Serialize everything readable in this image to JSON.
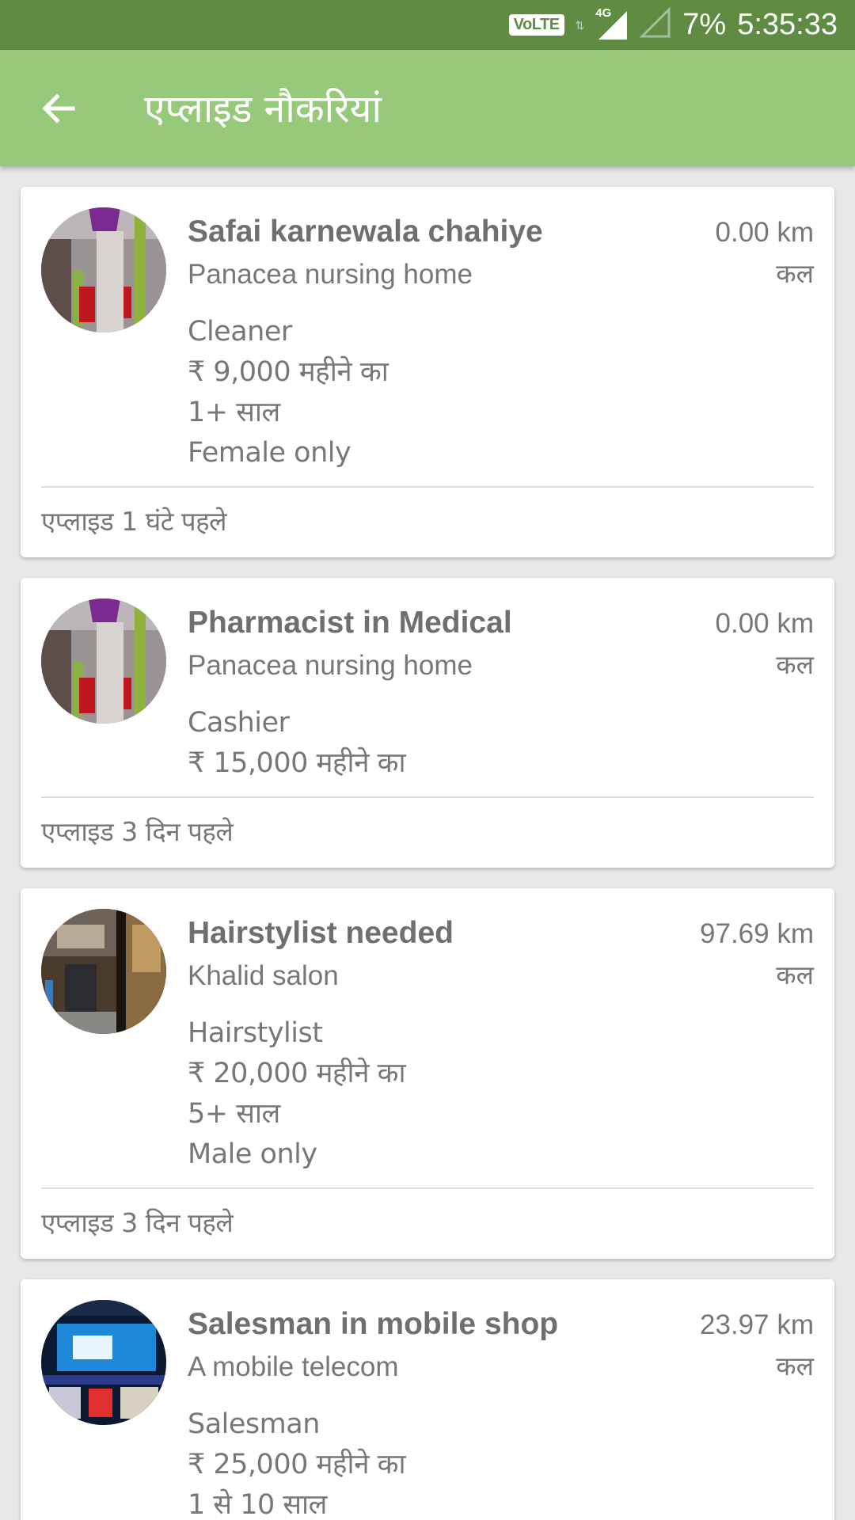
{
  "status_bar": {
    "volte": "VoLTE",
    "network": "4G",
    "battery": "7%",
    "time": "5:35:33"
  },
  "app_bar": {
    "back_icon": "arrow-left-icon",
    "title": "एप्लाइड नौकरियां"
  },
  "jobs": [
    {
      "title": "Safai karnewala chahiye",
      "company": "Panacea nursing home",
      "distance": "0.00 km",
      "when": "कल",
      "details": [
        "Cleaner",
        "₹ 9,000 महीने का",
        "1+ साल",
        "Female only"
      ],
      "applied": "एप्लाइड 1 घंटे पहले"
    },
    {
      "title": "Pharmacist in Medical",
      "company": "Panacea nursing home",
      "distance": "0.00 km",
      "when": "कल",
      "details": [
        "Cashier",
        "₹ 15,000 महीने का"
      ],
      "applied": "एप्लाइड 3 दिन पहले"
    },
    {
      "title": "Hairstylist needed",
      "company": "Khalid salon",
      "distance": "97.69 km",
      "when": "कल",
      "details": [
        "Hairstylist",
        "₹ 20,000 महीने का",
        "5+ साल",
        "Male only"
      ],
      "applied": "एप्लाइड 3 दिन पहले"
    },
    {
      "title": "Salesman in mobile shop",
      "company": "A mobile telecom",
      "distance": "23.97 km",
      "when": "कल",
      "details": [
        "Salesman",
        "₹ 25,000 महीने का",
        "1 से 10 साल"
      ],
      "applied": ""
    }
  ],
  "colors": {
    "status_bar": "#5f8b43",
    "app_bar": "#97c97a",
    "text_gray": "#777777"
  }
}
